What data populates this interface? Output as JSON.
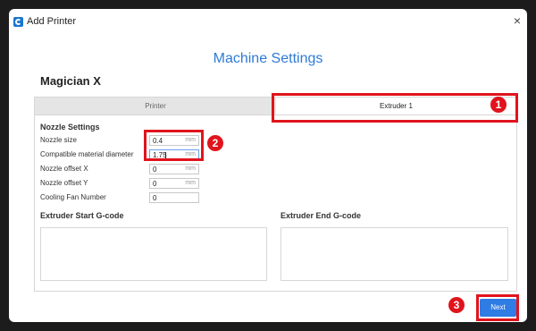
{
  "window": {
    "title": "Add Printer",
    "close_glyph": "×",
    "app_icon": "creality-logo-icon"
  },
  "page": {
    "heading": "Machine Settings",
    "machine_name": "Magician X"
  },
  "tabs": [
    {
      "label": "Printer",
      "active": false
    },
    {
      "label": "Extruder 1",
      "active": true
    }
  ],
  "nozzle_settings": {
    "title": "Nozzle Settings",
    "fields": [
      {
        "label": "Nozzle size",
        "value": "0.4",
        "unit": "mm"
      },
      {
        "label": "Compatible material diameter",
        "value": "1.75",
        "unit": "mm"
      },
      {
        "label": "Nozzle offset X",
        "value": "0",
        "unit": "mm"
      },
      {
        "label": "Nozzle offset Y",
        "value": "0",
        "unit": "mm"
      },
      {
        "label": "Cooling Fan Number",
        "value": "0",
        "unit": ""
      }
    ]
  },
  "gcode": {
    "start_label": "Extruder Start G-code",
    "end_label": "Extruder End G-code"
  },
  "buttons": {
    "next": "Next"
  },
  "annotations": {
    "badge_1": "1",
    "badge_2": "2",
    "badge_3": "3",
    "color": "#e0141c"
  },
  "colors": {
    "accent": "#2f7ce4",
    "heading": "#2e7bd6"
  }
}
